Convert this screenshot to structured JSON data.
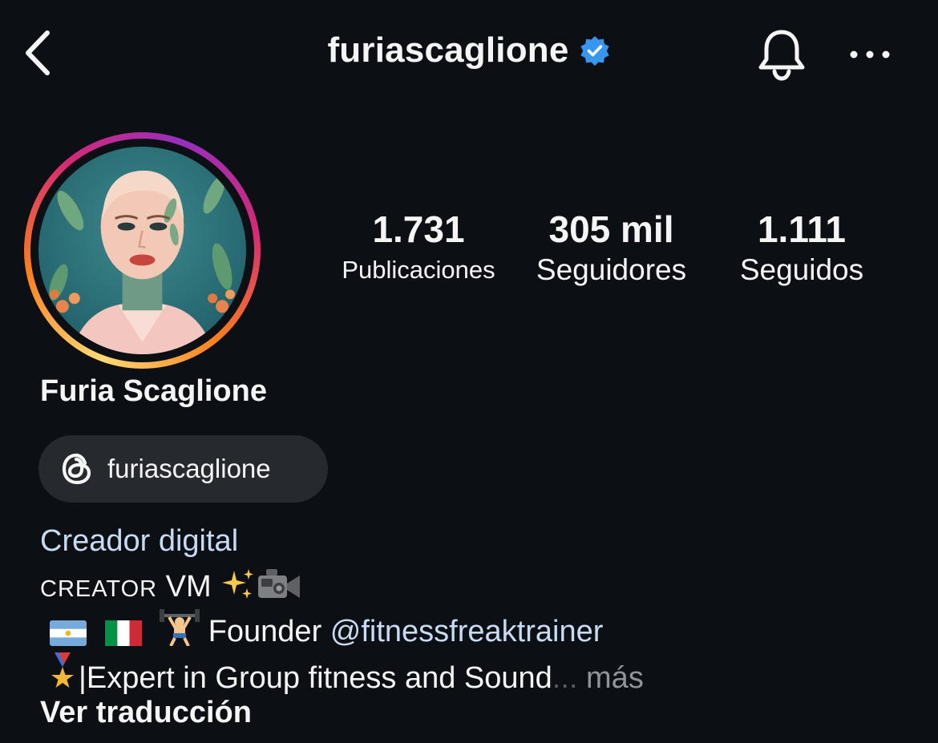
{
  "header": {
    "username": "furiascaglione",
    "back_icon": "chevron-left-icon",
    "verified_icon": "verified-badge-icon",
    "bell_icon": "bell-icon",
    "more_icon": "more-horizontal-icon",
    "verified_color": "#3797f0"
  },
  "stats": [
    {
      "value": "1.731",
      "label": "Publicaciones"
    },
    {
      "value": "305 mil",
      "label": "Seguidores"
    },
    {
      "value": "1.111",
      "label": "Seguidos"
    }
  ],
  "profile": {
    "name": "Furia Scaglione",
    "threads_handle": "furiascaglione",
    "category": "Creador digital",
    "bio_line1_smallcaps": "CREATOR",
    "bio_line1_rest": " VM ",
    "bio_line2_text": "Founder ",
    "bio_line2_mention": "@fitnessfreaktrainer",
    "bio_line3_text": "|Expert in Group fitness and Sound",
    "bio_line3_ellipsis": "...",
    "more_label": " más",
    "translate_label": "Ver traducción"
  },
  "colors": {
    "background": "#0c1014",
    "pill": "#262a2f",
    "link": "#c8dbf3",
    "muted": "#8e949b"
  }
}
